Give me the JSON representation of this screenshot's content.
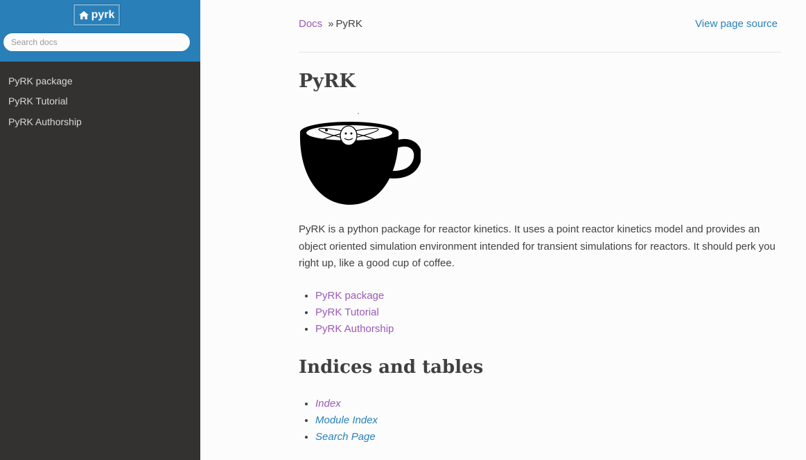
{
  "sidebar": {
    "home_label": "pyrk",
    "home_icon": "home-icon",
    "search_placeholder": "Search docs",
    "items": [
      {
        "label": "PyRK package"
      },
      {
        "label": "PyRK Tutorial"
      },
      {
        "label": "PyRK Authorship"
      }
    ]
  },
  "breadcrumb": {
    "docs": "Docs",
    "separator": "»",
    "current": "PyRK",
    "view_source": "View page source"
  },
  "main": {
    "title": "PyRK",
    "intro": "PyRK is a python package for reactor kinetics. It uses a point reactor kinetics model and provides an object oriented simulation environment intended for transient simulations for reactors. It should perk you right up, like a good cup of coffee.",
    "toc": [
      {
        "label": "PyRK package"
      },
      {
        "label": "PyRK Tutorial"
      },
      {
        "label": "PyRK Authorship"
      }
    ],
    "indices_title": "Indices and tables",
    "indices": [
      {
        "label": "Index"
      },
      {
        "label": "Module Index"
      },
      {
        "label": "Search Page"
      }
    ]
  },
  "colors": {
    "sidebar_bg": "#343131",
    "header_bg": "#2980b9",
    "link_visited": "#9b59b6",
    "link": "#2980b9",
    "text": "#404040"
  }
}
